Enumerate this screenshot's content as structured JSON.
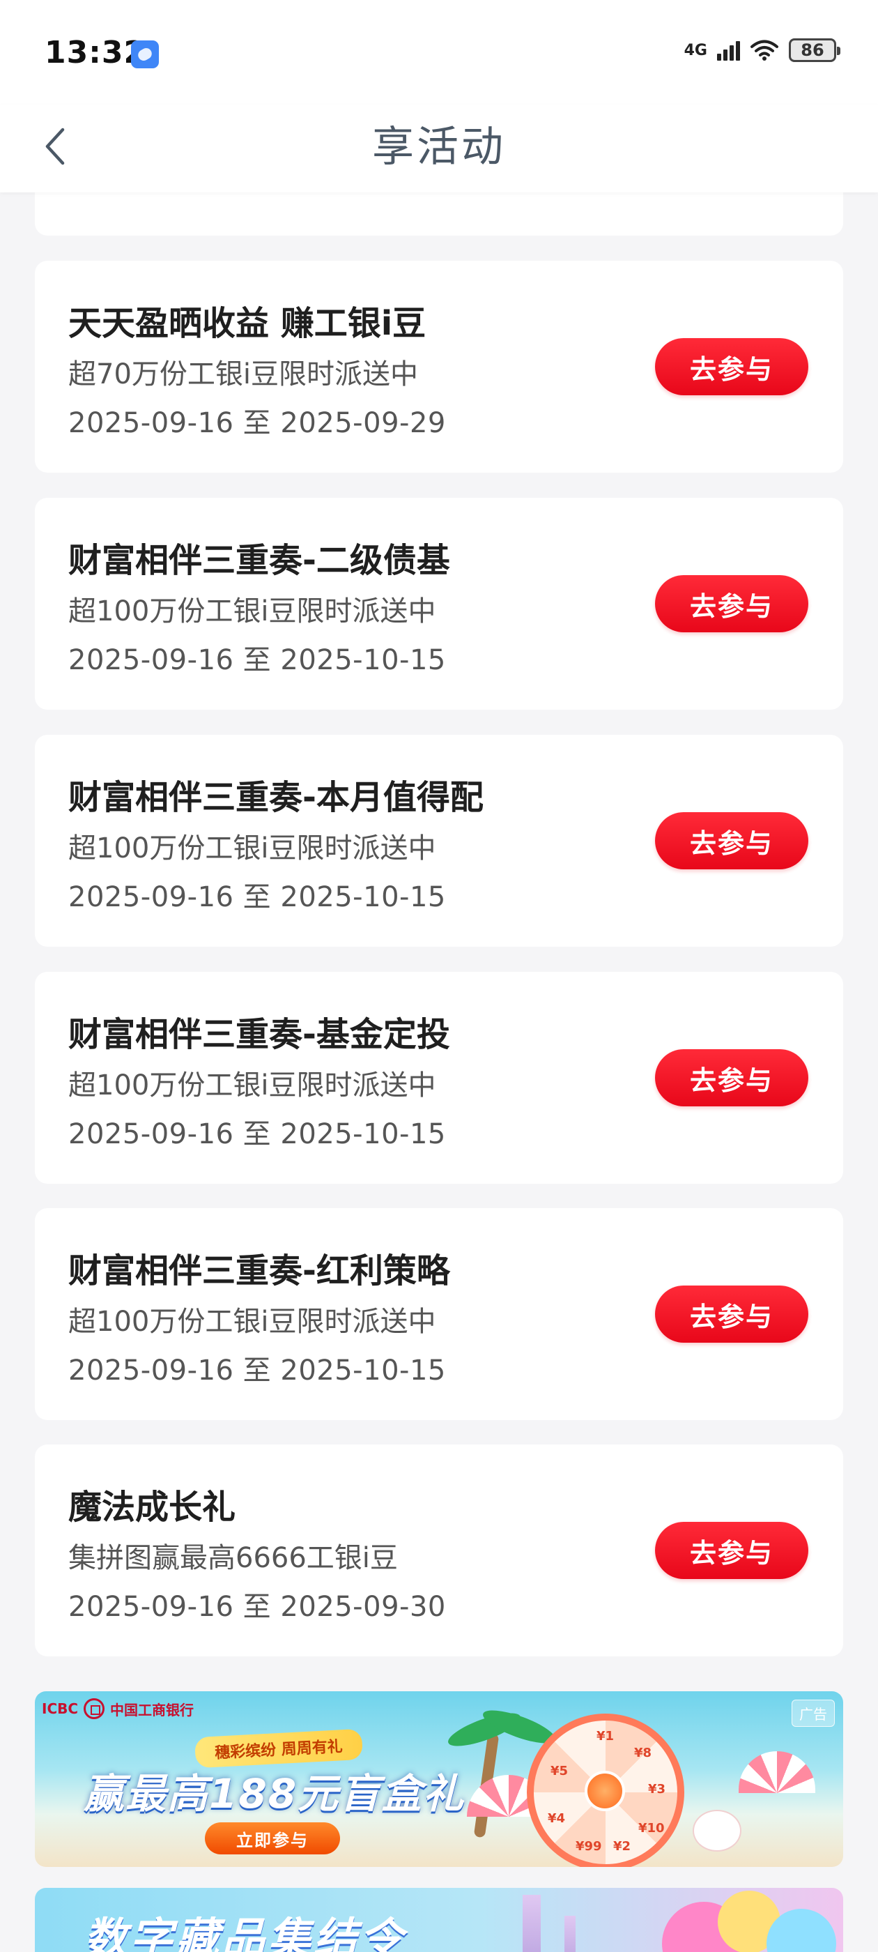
{
  "status_bar": {
    "time": "13:32",
    "network": "4G",
    "battery": "86"
  },
  "header": {
    "title": "享活动",
    "back_icon": "chevron-left-icon"
  },
  "activities": [
    {
      "title": "天天盈晒收益 赚工银i豆",
      "description": "超70万份工银i豆限时派送中",
      "date_range": "2025-09-16 至 2025-09-29",
      "button": "去参与"
    },
    {
      "title": "财富相伴三重奏-二级债基",
      "description": "超100万份工银i豆限时派送中",
      "date_range": "2025-09-16 至 2025-10-15",
      "button": "去参与"
    },
    {
      "title": "财富相伴三重奏-本月值得配",
      "description": "超100万份工银i豆限时派送中",
      "date_range": "2025-09-16 至 2025-10-15",
      "button": "去参与"
    },
    {
      "title": "财富相伴三重奏-基金定投",
      "description": "超100万份工银i豆限时派送中",
      "date_range": "2025-09-16 至 2025-10-15",
      "button": "去参与"
    },
    {
      "title": "财富相伴三重奏-红利策略",
      "description": "超100万份工银i豆限时派送中",
      "date_range": "2025-09-16 至 2025-10-15",
      "button": "去参与"
    },
    {
      "title": "魔法成长礼",
      "description": "集拼图赢最高6666工银i豆",
      "date_range": "2025-09-16 至 2025-09-30",
      "button": "去参与"
    }
  ],
  "banner_ad": {
    "bank_code": "ICBC",
    "bank_name": "中国工商银行",
    "ad_label": "广告",
    "ribbon": "穗彩缤纷 周周有礼",
    "headline": "赢最高188元盲盒礼",
    "cta": "立即参与",
    "wheel_labels": [
      "¥1",
      "¥8",
      "¥3",
      "¥10",
      "¥2",
      "¥99",
      "¥4",
      "¥5"
    ]
  },
  "banner_ad_2": {
    "headline": "数字藏品集结令"
  },
  "colors": {
    "accent_red": "#e8071a",
    "title_gray": "#4b5866",
    "background": "#f5f5f7"
  }
}
